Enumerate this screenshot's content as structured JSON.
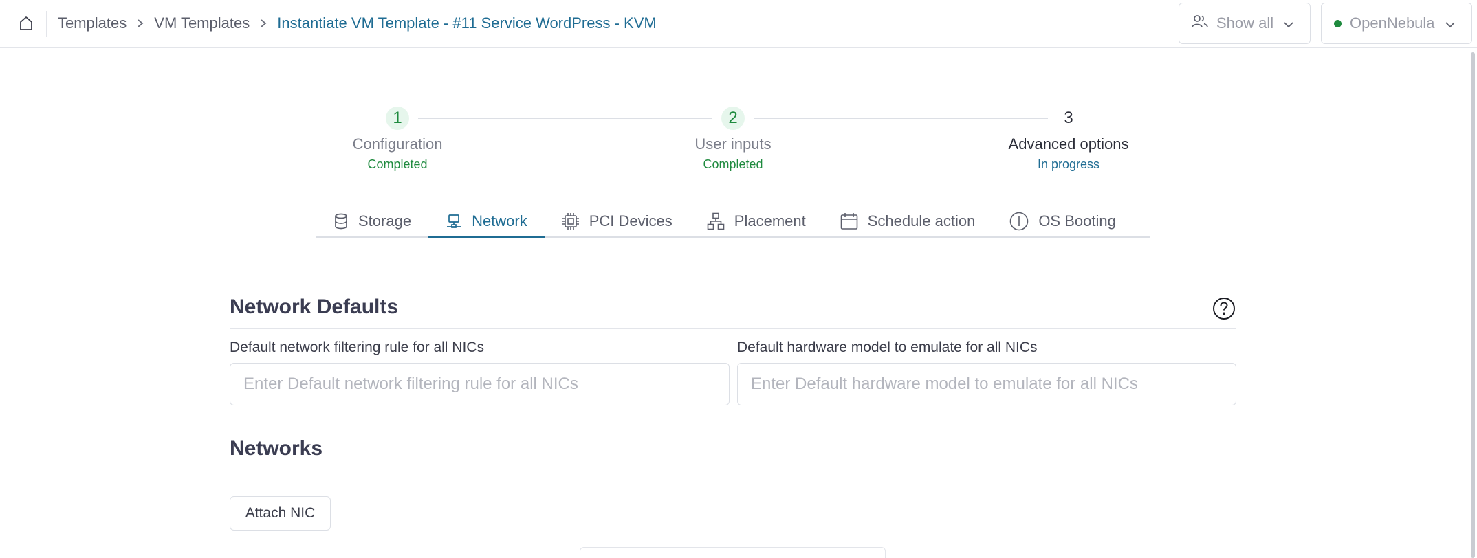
{
  "header": {
    "breadcrumb": [
      {
        "label": "Templates"
      },
      {
        "label": "VM Templates"
      },
      {
        "label": "Instantiate VM Template - #11 Service WordPress - KVM"
      }
    ],
    "group_filter_label": "Show all",
    "zone_label": "OpenNebula",
    "zone_status_color": "#1e8a3e"
  },
  "stepper": [
    {
      "number": "1",
      "title": "Configuration",
      "status": "Completed"
    },
    {
      "number": "2",
      "title": "User inputs",
      "status": "Completed"
    },
    {
      "number": "3",
      "title": "Advanced options",
      "status": "In progress"
    }
  ],
  "tabs": [
    {
      "label": "Storage",
      "icon": "database-icon"
    },
    {
      "label": "Network",
      "icon": "network-icon",
      "active": true
    },
    {
      "label": "PCI Devices",
      "icon": "chip-icon"
    },
    {
      "label": "Placement",
      "icon": "hierarchy-icon"
    },
    {
      "label": "Schedule action",
      "icon": "calendar-icon"
    },
    {
      "label": "OS Booting",
      "icon": "info-icon"
    }
  ],
  "network_defaults": {
    "title": "Network Defaults",
    "filter_label": "Default network filtering rule for all NICs",
    "filter_placeholder": "Enter Default network filtering rule for all NICs",
    "filter_value": "",
    "model_label": "Default hardware model to emulate for all NICs",
    "model_placeholder": "Enter Default hardware model to emulate for all NICs",
    "model_value": ""
  },
  "networks": {
    "title": "Networks",
    "attach_label": "Attach NIC"
  },
  "colors": {
    "accent": "#1f6c93",
    "success": "#1e8a3e"
  }
}
